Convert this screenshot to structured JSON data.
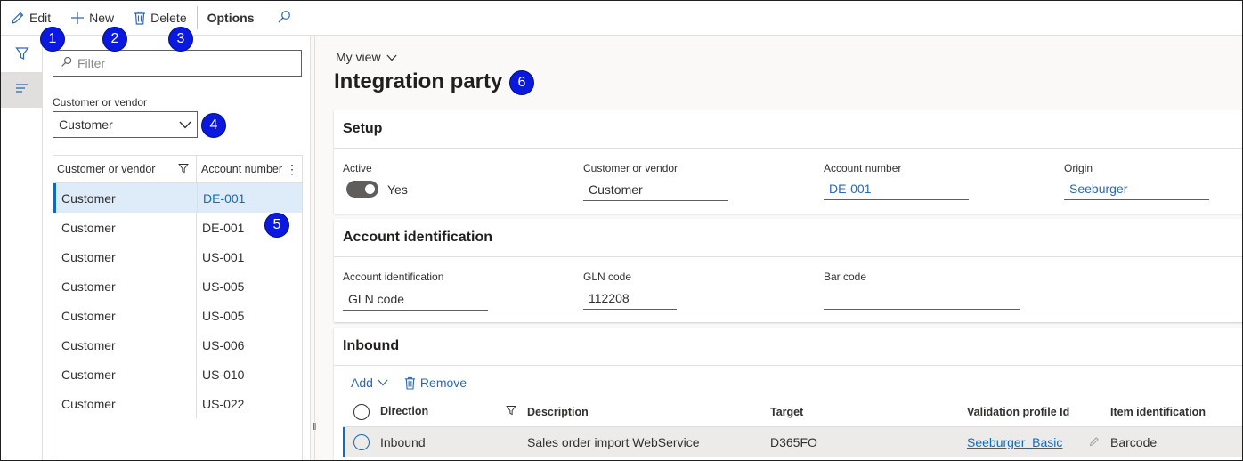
{
  "toolbar": {
    "edit_label": "Edit",
    "new_label": "New",
    "delete_label": "Delete",
    "options_label": "Options"
  },
  "badges": [
    "1",
    "2",
    "3",
    "4",
    "5",
    "6"
  ],
  "list": {
    "filter_placeholder": "Filter",
    "cv_label": "Customer or vendor",
    "cv_value": "Customer",
    "columns": [
      "Customer or vendor",
      "Account number"
    ],
    "rows": [
      {
        "type": "Customer",
        "account": "DE-001"
      },
      {
        "type": "Customer",
        "account": "DE-001"
      },
      {
        "type": "Customer",
        "account": "US-001"
      },
      {
        "type": "Customer",
        "account": "US-005"
      },
      {
        "type": "Customer",
        "account": "US-005"
      },
      {
        "type": "Customer",
        "account": "US-006"
      },
      {
        "type": "Customer",
        "account": "US-010"
      },
      {
        "type": "Customer",
        "account": "US-022"
      }
    ]
  },
  "main": {
    "view_label": "My view",
    "title": "Integration party",
    "setup": {
      "header": "Setup",
      "active_label": "Active",
      "active_value": "Yes",
      "cv_label": "Customer or vendor",
      "cv_value": "Customer",
      "account_label": "Account number",
      "account_value": "DE-001",
      "origin_label": "Origin",
      "origin_value": "Seeburger"
    },
    "account_id": {
      "header": "Account identification",
      "aid_label": "Account identification",
      "aid_value": "GLN code",
      "gln_label": "GLN code",
      "gln_value": "112208",
      "bar_label": "Bar code",
      "bar_value": ""
    },
    "inbound": {
      "header": "Inbound",
      "add_label": "Add",
      "remove_label": "Remove",
      "columns": [
        "Direction",
        "Description",
        "Target",
        "Validation profile Id",
        "Item identification"
      ],
      "row": {
        "direction": "Inbound",
        "description": "Sales order import WebService",
        "target": "D365FO",
        "profile": "Seeburger_Basic",
        "item_id": "Barcode"
      }
    }
  },
  "colors": {
    "accent": "#0f6cbd",
    "badge": "#0a18e0",
    "link": "#2b68b3"
  }
}
